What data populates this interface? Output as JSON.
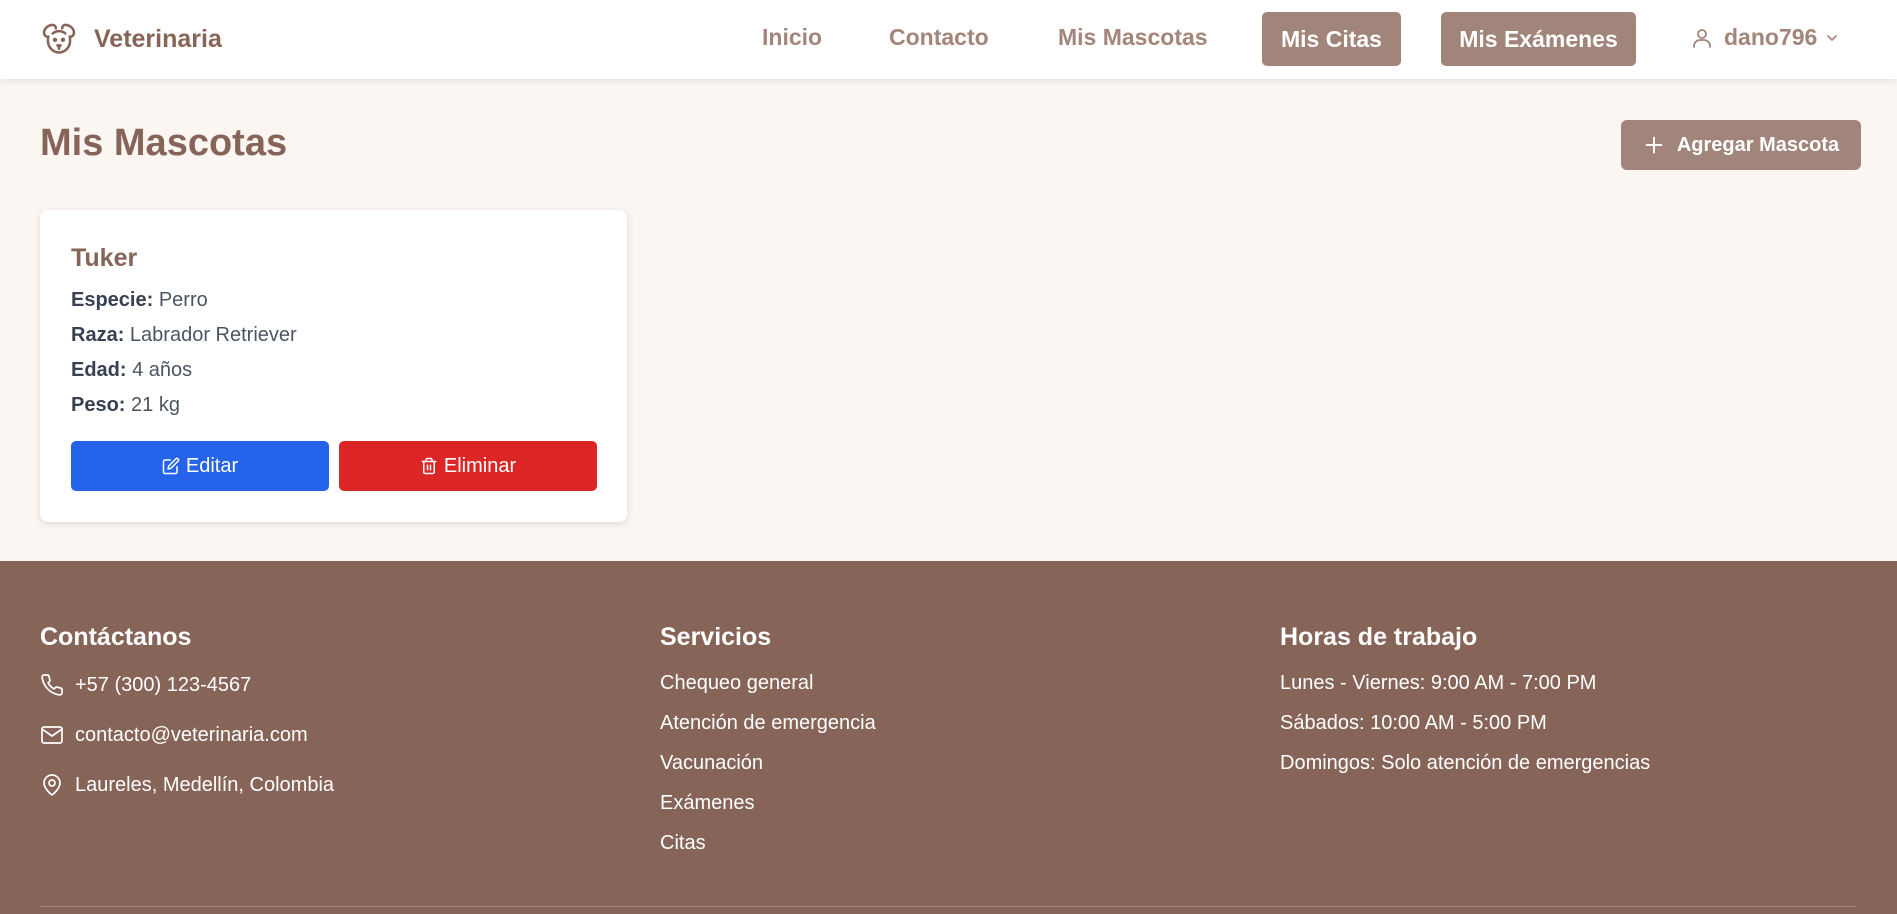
{
  "navbar": {
    "brand": "Veterinaria",
    "links": {
      "inicio": "Inicio",
      "contacto": "Contacto",
      "mascotas": "Mis Mascotas"
    },
    "buttons": {
      "citas": "Mis Citas",
      "examenes": "Mis Exámenes"
    },
    "user": "dano796"
  },
  "main": {
    "title": "Mis Mascotas",
    "add_button": "Agregar Mascota",
    "pets": [
      {
        "name": "Tuker",
        "species_label": "Especie:",
        "species": "Perro",
        "breed_label": "Raza:",
        "breed": "Labrador Retriever",
        "age_label": "Edad:",
        "age": "4 años",
        "weight_label": "Peso:",
        "weight": "21 kg",
        "edit_label": "Editar",
        "delete_label": "Eliminar"
      }
    ]
  },
  "footer": {
    "contact": {
      "title": "Contáctanos",
      "phone": "+57 (300) 123-4567",
      "email": "contacto@veterinaria.com",
      "address": "Laureles, Medellín, Colombia"
    },
    "services": {
      "title": "Servicios",
      "items": [
        "Chequeo general",
        "Atención de emergencia",
        "Vacunación",
        "Exámenes",
        "Citas"
      ]
    },
    "hours": {
      "title": "Horas de trabajo",
      "items": [
        "Lunes - Viernes: 9:00 AM - 7:00 PM",
        "Sábados: 10:00 AM - 5:00 PM",
        "Domingos: Solo atención de emergencias"
      ]
    }
  },
  "colors": {
    "brand": "#876458",
    "nav_button": "#a2857a",
    "edit": "#2563eb",
    "delete": "#dc2626",
    "background": "#fcf6f3"
  },
  "icons": [
    "dog-logo-icon",
    "user-icon",
    "chevron-down-icon",
    "plus-icon",
    "edit-icon",
    "trash-icon",
    "phone-icon",
    "mail-icon",
    "map-pin-icon"
  ]
}
